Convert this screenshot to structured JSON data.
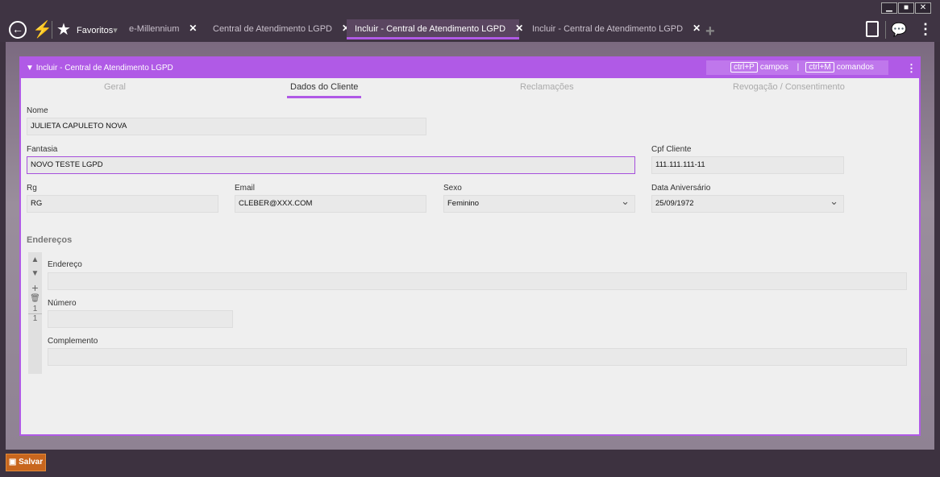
{
  "window": {
    "minimize": "▁",
    "maximize": "■",
    "close": "✕"
  },
  "topbar": {
    "favorites": "Favoritos",
    "favorites_caret": "▾",
    "tabs": [
      {
        "label": "e-Millennium",
        "close": "✕"
      },
      {
        "label": "Central de Atendimento LGPD",
        "close": "✕"
      },
      {
        "label": "Incluir - Central de Atendimento LGPD",
        "close": "✕"
      },
      {
        "label": "Incluir - Central de Atendimento LGPD",
        "close": "✕"
      }
    ],
    "new_tab": "+"
  },
  "panel": {
    "title": "Incluir - Central de Atendimento LGPD",
    "shortcut_p": "ctrl+P",
    "campos": "campos",
    "sep": "|",
    "shortcut_m": "ctrl+M",
    "comandos": "comandos",
    "menu": "⋮"
  },
  "tabs": [
    "Geral",
    "Dados do Cliente",
    "Reclamações",
    "Revogação / Consentimento"
  ],
  "form": {
    "nome": {
      "label": "Nome",
      "value": "JULIETA CAPULETO NOVA"
    },
    "fantasia": {
      "label": "Fantasia",
      "value": "NOVO TESTE LGPD"
    },
    "cpf": {
      "label": "Cpf Cliente",
      "value": "111.111.111-11"
    },
    "rg": {
      "label": "Rg",
      "value": "RG"
    },
    "email": {
      "label": "Email",
      "value": "CLEBER@XXX.COM"
    },
    "sexo": {
      "label": "Sexo",
      "value": "Feminino"
    },
    "data": {
      "label": "Data Aniversário",
      "value": "25/09/1972"
    }
  },
  "enderecos": {
    "title": "Endereços",
    "endereco": "Endereço",
    "numero": "Número",
    "complemento": "Complemento",
    "current": "1",
    "total": "1"
  },
  "footer": {
    "save": "Salvar"
  }
}
